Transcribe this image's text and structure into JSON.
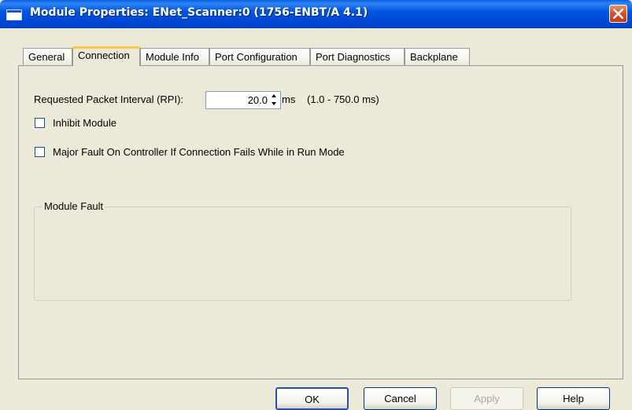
{
  "window": {
    "title": "Module Properties: ENet_Scanner:0 (1756-ENBT/A 4.1)"
  },
  "tabs": [
    {
      "label": "General",
      "active": false
    },
    {
      "label": "Connection",
      "active": true
    },
    {
      "label": "Module Info",
      "active": false
    },
    {
      "label": "Port Configuration",
      "active": false
    },
    {
      "label": "Port Diagnostics",
      "active": false
    },
    {
      "label": "Backplane",
      "active": false
    }
  ],
  "connection": {
    "rpi_label": "Requested Packet Interval (RPI):",
    "rpi_value": "20.0",
    "rpi_unit": "ms",
    "rpi_range": "(1.0 - 750.0 ms)",
    "inhibit_label": "Inhibit Module",
    "inhibit_checked": false,
    "major_fault_label": "Major Fault On Controller If Connection Fails While in Run Mode",
    "major_fault_checked": false,
    "module_fault_title": "Module Fault"
  },
  "buttons": {
    "ok": "OK",
    "cancel": "Cancel",
    "apply": "Apply",
    "help": "Help"
  },
  "colors": {
    "titlebar": "#0055e5",
    "face": "#ece9d8",
    "close": "#d9542c"
  }
}
